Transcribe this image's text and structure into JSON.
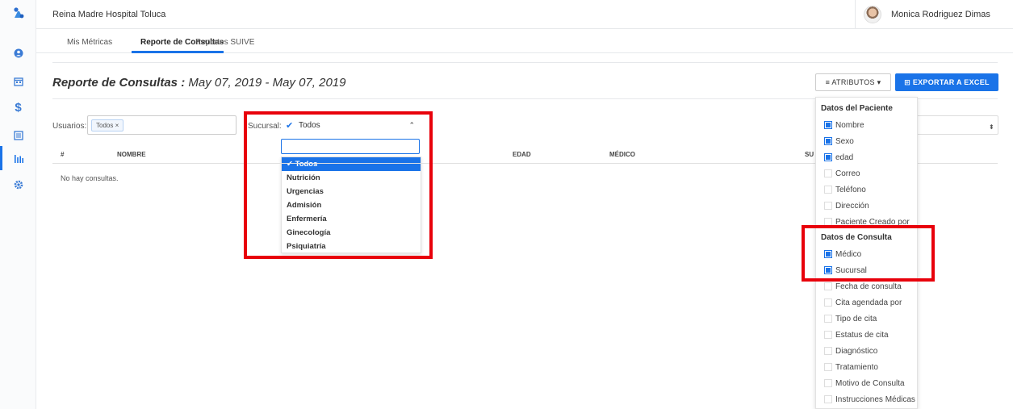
{
  "header": {
    "org_name": "Reina Madre Hospital Toluca",
    "user_name": "Monica Rodriguez Dimas"
  },
  "tabs": [
    {
      "label": "Mis Métricas",
      "active": false
    },
    {
      "label": "Reporte de Consultas",
      "active": true
    },
    {
      "label": "Reportes SUIVE",
      "active": false
    }
  ],
  "report": {
    "title": "Reporte de Consultas :",
    "date_range": "May 07, 2019 - May 07, 2019"
  },
  "buttons": {
    "attributes": "≡ ATRIBUTOS ▾",
    "export": "⊞ EXPORTAR A EXCEL"
  },
  "filters": {
    "usuarios_label": "Usuarios:",
    "usuarios_chip": "Todos ×",
    "sucursal_label": "Sucursal:",
    "sucursal_value": "Todos"
  },
  "dropdown": {
    "search_value": "",
    "options": [
      "✔ Todos",
      "Nutrición",
      "Urgencias",
      "Admisión",
      "Enfermería",
      "Ginecología",
      "Psiquiatría"
    ],
    "selected_index": 0
  },
  "table": {
    "columns": [
      "#",
      "NOMBRE",
      "EDAD",
      "MÉDICO",
      "SU"
    ],
    "empty_message": "No hay consultas."
  },
  "attributes_panel": {
    "patient_header": "Datos del Paciente",
    "patient_items": [
      {
        "label": "Nombre",
        "checked": true
      },
      {
        "label": "Sexo",
        "checked": true
      },
      {
        "label": "edad",
        "checked": true
      },
      {
        "label": "Correo",
        "checked": false
      },
      {
        "label": "Teléfono",
        "checked": false
      },
      {
        "label": "Dirección",
        "checked": false
      },
      {
        "label": "Paciente Creado por",
        "checked": false
      }
    ],
    "consult_header": "Datos de Consulta",
    "consult_items": [
      {
        "label": "Médico",
        "checked": true
      },
      {
        "label": "Sucursal",
        "checked": true
      },
      {
        "label": "Fecha de consulta",
        "checked": false
      },
      {
        "label": "Cita agendada por",
        "checked": false
      },
      {
        "label": "Tipo de cita",
        "checked": false
      },
      {
        "label": "Estatus de cita",
        "checked": false
      },
      {
        "label": "Diagnóstico",
        "checked": false
      },
      {
        "label": "Tratamiento",
        "checked": false
      },
      {
        "label": "Motivo de Consulta",
        "checked": false
      },
      {
        "label": "Instrucciones Médicas",
        "checked": false
      }
    ]
  },
  "colors": {
    "accent": "#1a73e8",
    "highlight": "#e8000b"
  }
}
